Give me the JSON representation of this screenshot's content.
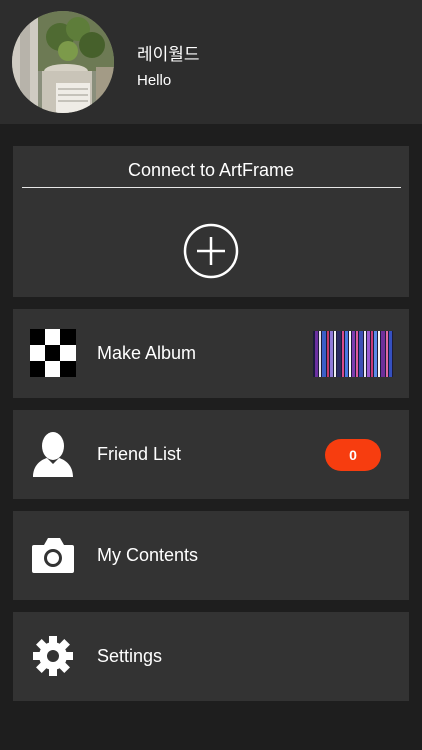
{
  "profile": {
    "name": "레이월드",
    "status": "Hello"
  },
  "connect": {
    "title": "Connect to ArtFrame"
  },
  "menu": {
    "items": [
      {
        "label": "Make Album",
        "icon": "checker-icon"
      },
      {
        "label": "Friend List",
        "icon": "person-icon",
        "badge": "0"
      },
      {
        "label": "My Contents",
        "icon": "camera-icon"
      },
      {
        "label": "Settings",
        "icon": "gear-icon"
      }
    ]
  },
  "colors": {
    "background": "#1e1e1e",
    "header": "#2d2d2d",
    "card": "#333333",
    "badge": "#f73d0f"
  }
}
